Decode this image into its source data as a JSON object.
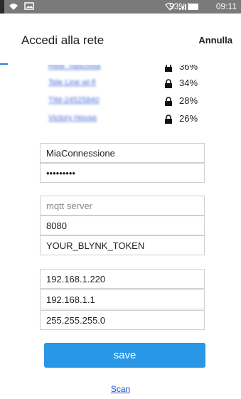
{
  "status_bar": {
    "battery": "93%",
    "time": "09:11"
  },
  "header": {
    "title": "Accedi alla rete",
    "cancel": "Annulla"
  },
  "networks": [
    {
      "ssid": "Rete_nascosta",
      "signal": "36%",
      "secured": true
    },
    {
      "ssid": "Tele Line wi-fi",
      "signal": "34%",
      "secured": true
    },
    {
      "ssid": "TIM-24525840",
      "signal": "28%",
      "secured": true
    },
    {
      "ssid": "Victory House",
      "signal": "26%",
      "secured": true
    }
  ],
  "wifi_form": {
    "ssid_value": "MiaConnessione",
    "password_value": "•••••••••"
  },
  "mqtt_form": {
    "server_placeholder": "mqtt server",
    "port_value": "8080",
    "token_value": "YOUR_BLYNK_TOKEN"
  },
  "ip_form": {
    "ip_value": "192.168.1.220",
    "gateway_value": "192.168.1.1",
    "subnet_value": "255.255.255.0"
  },
  "actions": {
    "save_label": "save",
    "scan_label": "Scan"
  }
}
